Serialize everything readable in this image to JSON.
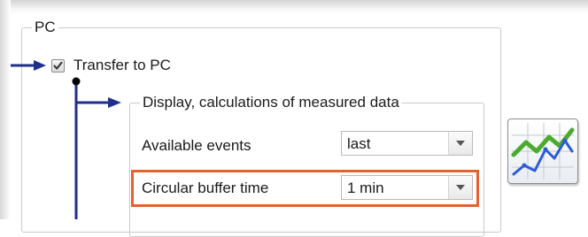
{
  "group_pc": {
    "title": "PC"
  },
  "transfer": {
    "label": "Transfer to PC",
    "checked": true
  },
  "display_group": {
    "title": "Display, calculations of measured data"
  },
  "available_events": {
    "label": "Available events",
    "value": "last"
  },
  "circular_buffer": {
    "label": "Circular buffer time",
    "value": "1 min"
  },
  "icons": {
    "checkbox": "checkmark-icon",
    "dropdown": "chevron-down-icon",
    "chart": "line-chart-icon"
  },
  "colors": {
    "connector": "#1f2f8c",
    "highlight": "#e2632b",
    "checkmark": "#3b3b3b",
    "chart_green": "#4caa2f",
    "chart_blue": "#2d5cd4"
  }
}
